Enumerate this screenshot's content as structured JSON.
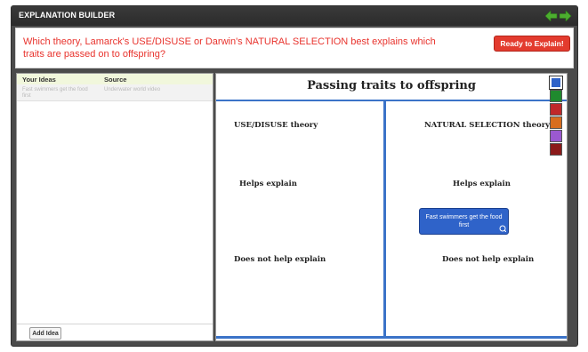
{
  "window": {
    "title": "EXPLANATION BUILDER",
    "nav": {
      "back_icon": "arrow-left-icon",
      "forward_icon": "arrow-right-icon"
    }
  },
  "question": {
    "text": "Which theory, Lamarck's USE/DISUSE or Darwin's NATURAL SELECTION best explains which traits are passed on to offspring?",
    "ready_button": "Ready to Explain!"
  },
  "ideas": {
    "columns": [
      "Your Ideas",
      "Source"
    ],
    "rows": [
      {
        "idea": "Fast swimmers get the food first",
        "source": "Underwater world video"
      }
    ],
    "add_button": "Add Idea"
  },
  "board": {
    "title": "Passing traits to offspring",
    "columns": [
      "USE/DISUSE theory",
      "NATURAL SELECTION theory"
    ],
    "rows": [
      "Helps explain",
      "Does not help explain"
    ],
    "cards": [
      {
        "text": "Fast swimmers get the food first",
        "column": 1,
        "row": 0
      }
    ]
  },
  "swatches": [
    "#2f63c9",
    "#1f8a2e",
    "#c0282a",
    "#d86d1f",
    "#9b59d0",
    "#8b1a1a"
  ],
  "colors": {
    "accent_blue": "#3b73c8",
    "question_red": "#e8332d",
    "ready_red": "#e33b2e",
    "nav_green": "#4cae2f"
  }
}
